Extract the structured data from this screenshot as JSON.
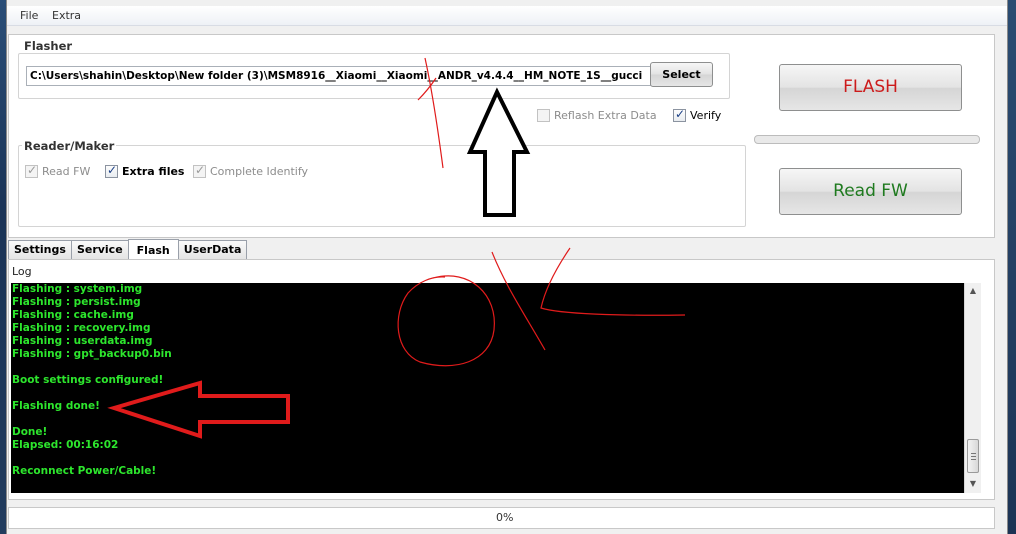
{
  "menu": [
    "File",
    "Extra"
  ],
  "flasher": {
    "title": "Flasher",
    "path_value": "C:\\Users\\shahin\\Desktop\\New folder (3)\\MSM8916__Xiaomi__Xiaomi__ANDR_v4.4.4__HM_NOTE_1S__gucci",
    "select_label": "Select",
    "reflash_extra_label": "Reflash Extra Data",
    "reflash_extra_checked": false,
    "reflash_extra_enabled": false,
    "verify_label": "Verify",
    "verify_checked": true
  },
  "reader": {
    "title": "Reader/Maker",
    "read_fw_label": "Read FW",
    "read_fw_checked": true,
    "read_fw_enabled": false,
    "extra_files_label": "Extra files",
    "extra_files_checked": true,
    "complete_identify_label": "Complete Identify",
    "complete_identify_checked": true,
    "complete_identify_enabled": false
  },
  "buttons": {
    "flash_label": "FLASH",
    "read_fw_label": "Read FW"
  },
  "tabs": [
    {
      "label": "Settings",
      "active": false
    },
    {
      "label": "Service",
      "active": false
    },
    {
      "label": "Flash",
      "active": true
    },
    {
      "label": "UserData",
      "active": false
    }
  ],
  "log": {
    "label": "Log",
    "lines": [
      "Flashing : system.img",
      "Flashing : persist.img",
      "Flashing : cache.img",
      "Flashing : recovery.img",
      "Flashing : userdata.img",
      "Flashing : gpt_backup0.bin",
      "",
      "Boot settings configured!",
      "",
      "Flashing done!",
      "",
      "Done!",
      "Elapsed: 00:16:02",
      "",
      "Reconnect Power/Cable!"
    ]
  },
  "status": {
    "progress_percent": 0,
    "progress_text": "0%"
  },
  "colors": {
    "log_background": "#000000",
    "log_text": "#2de62d",
    "flash_text": "#cc1b1b",
    "read_text": "#1f7a1f",
    "annotation": "#e01b1b"
  }
}
